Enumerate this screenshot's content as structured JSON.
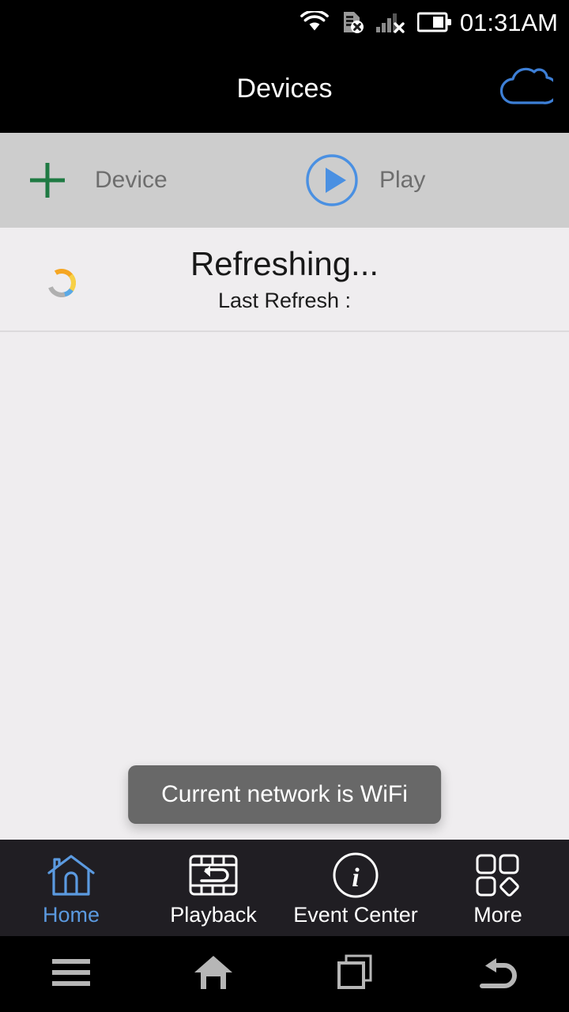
{
  "status_bar": {
    "time": "01:31AM",
    "icons": [
      {
        "name": "wifi-icon",
        "label": "wifi"
      },
      {
        "name": "sim-card-missing-icon",
        "label": "no-sim"
      },
      {
        "name": "cellular-signal-off-icon",
        "label": "signal-off"
      },
      {
        "name": "battery-icon",
        "label": "battery"
      }
    ]
  },
  "title_bar": {
    "title": "Devices",
    "cloud_icon": "cloud-icon"
  },
  "toolbar": {
    "add_icon": "plus-icon",
    "add_label": "Device",
    "play_icon": "play-circle-icon",
    "play_label": "Play"
  },
  "refresh": {
    "status": "Refreshing...",
    "last_refresh_label": "Last Refresh :",
    "spinner_icon": "loading-spinner-icon"
  },
  "toast": {
    "message": "Current network is WiFi"
  },
  "tab_bar": {
    "items": [
      {
        "label": "Home",
        "icon": "home-icon",
        "active": true
      },
      {
        "label": "Playback",
        "icon": "filmstrip-rewind-icon",
        "active": false
      },
      {
        "label": "Event Center",
        "icon": "info-circle-icon",
        "active": false
      },
      {
        "label": "More",
        "icon": "grid-more-icon",
        "active": false
      }
    ]
  },
  "system_nav": {
    "buttons": [
      {
        "name": "menu-button",
        "icon": "hamburger-menu-icon"
      },
      {
        "name": "home-button",
        "icon": "home-outline-icon"
      },
      {
        "name": "recents-button",
        "icon": "recent-apps-icon"
      },
      {
        "name": "back-button",
        "icon": "back-arrow-icon"
      }
    ]
  },
  "colors": {
    "accent_blue": "#4a90e2",
    "add_green": "#1f7a43",
    "toolbar_bg": "#cdcdcd",
    "content_bg": "#efedef",
    "tabbar_bg": "#201e23"
  }
}
